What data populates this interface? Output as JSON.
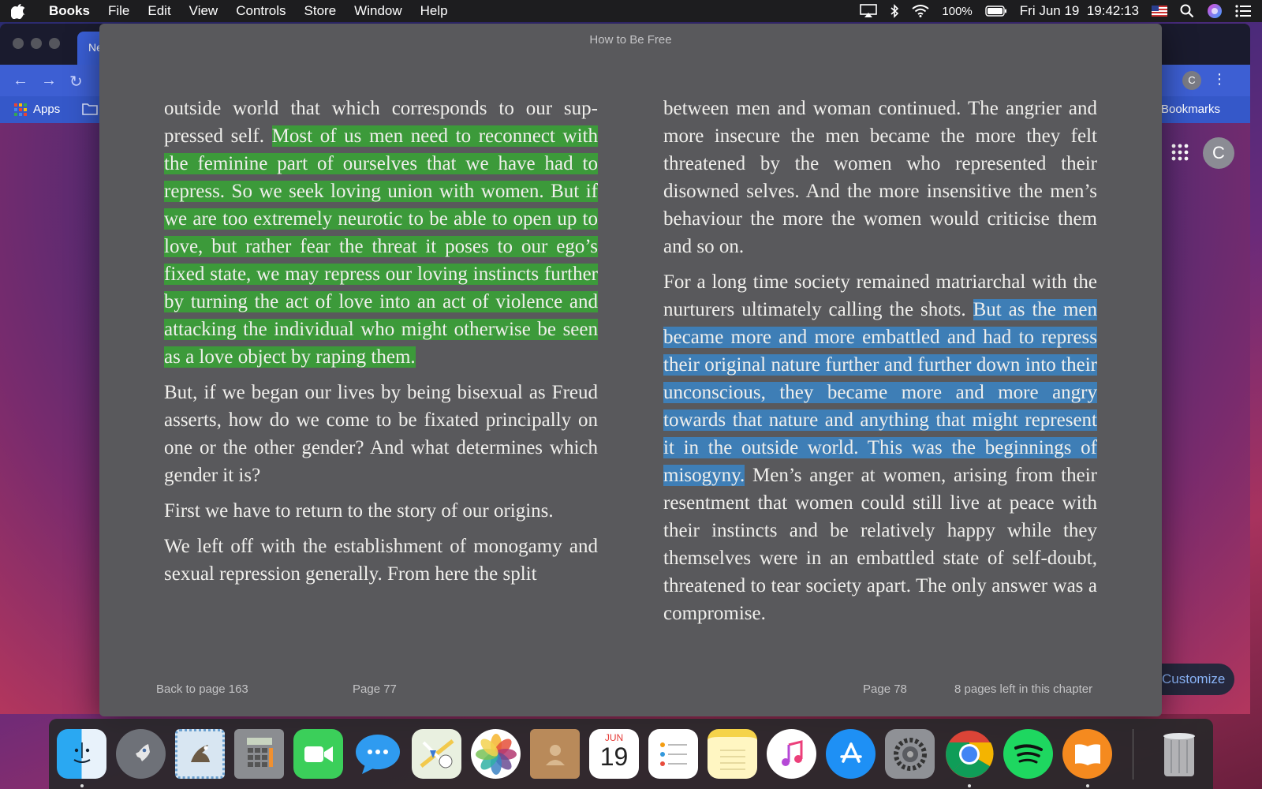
{
  "menubar": {
    "app_name": "Books",
    "items": [
      "File",
      "Edit",
      "View",
      "Controls",
      "Store",
      "Window",
      "Help"
    ],
    "battery": "100%",
    "datetime": "Fri Jun 19  19:42:13"
  },
  "browser": {
    "tab_title": "Ne",
    "bookmarks_apps": "Apps",
    "bookmarks_other": "her Bookmarks",
    "profile_initial": "C",
    "customize_label": "Customize"
  },
  "book": {
    "title": "How to Be Free",
    "left_page": {
      "p1_plain": "outside world that which corresponds to our sup­pressed self. ",
      "p1_highlight": "Most of us men need to reconnect with the feminine part of ourselves that we have had to repress. So we seek loving union with women. But if we are too extremely neurotic to be able to open up to love, but rather fear the threat it poses to our ego’s fixed state, we may repress our loving instincts further by turning the act of love into an act of violence and attacking the individual who might otherwise be seen as a love object by raping them.",
      "p2": "But, if we began our lives by being bisexual as Freud asserts, how do we come to be fixated princi­pally on one or the other gender? And what deter­mines which gender it is?",
      "p3": "First we have to return to the story of our origins.",
      "p4": "We left off with the establishment of monogamy and sexual repression generally. From here the split"
    },
    "right_page": {
      "p1": "between men and woman continued. The angrier and more insecure the men became the more they felt threatened by the women who represented their disowned selves. And the more insensitive the men’s behaviour the more the women would criti­cise them and so on.",
      "p2_plain_before": "For a long time society remained matriarchal with the nurturers ultimately calling the shots. ",
      "p2_highlight": "But as the men became more and more embattled and had to repress their original nature further and further down into their unconscious, they became more and more angry towards that nature and anything that might represent it in the outside world. This was the beginnings of misogyny.",
      "p2_plain_after": " Men’s anger at women, arising from their resentment that women could still live at peace with their instincts and be relatively happy while they themselves were in an embattled state of self-doubt, threatened to tear society apart. The only answer was a compromise."
    },
    "footer": {
      "back": "Back to page 163",
      "left_page_num": "Page 77",
      "right_page_num": "Page 78",
      "pages_left": "8 pages left in this chapter"
    },
    "colors": {
      "highlight_green": "#3c9a3a",
      "highlight_blue": "#3e7eb6"
    }
  },
  "dock": {
    "calendar_month": "JUN",
    "calendar_day": "19",
    "apps": [
      "finder",
      "launchpad",
      "mail",
      "calculator",
      "facetime",
      "messages",
      "maps",
      "photos",
      "contacts",
      "calendar",
      "reminders",
      "notes",
      "itunes",
      "app-store",
      "system-preferences",
      "chrome",
      "spotify",
      "books",
      "trash"
    ]
  }
}
